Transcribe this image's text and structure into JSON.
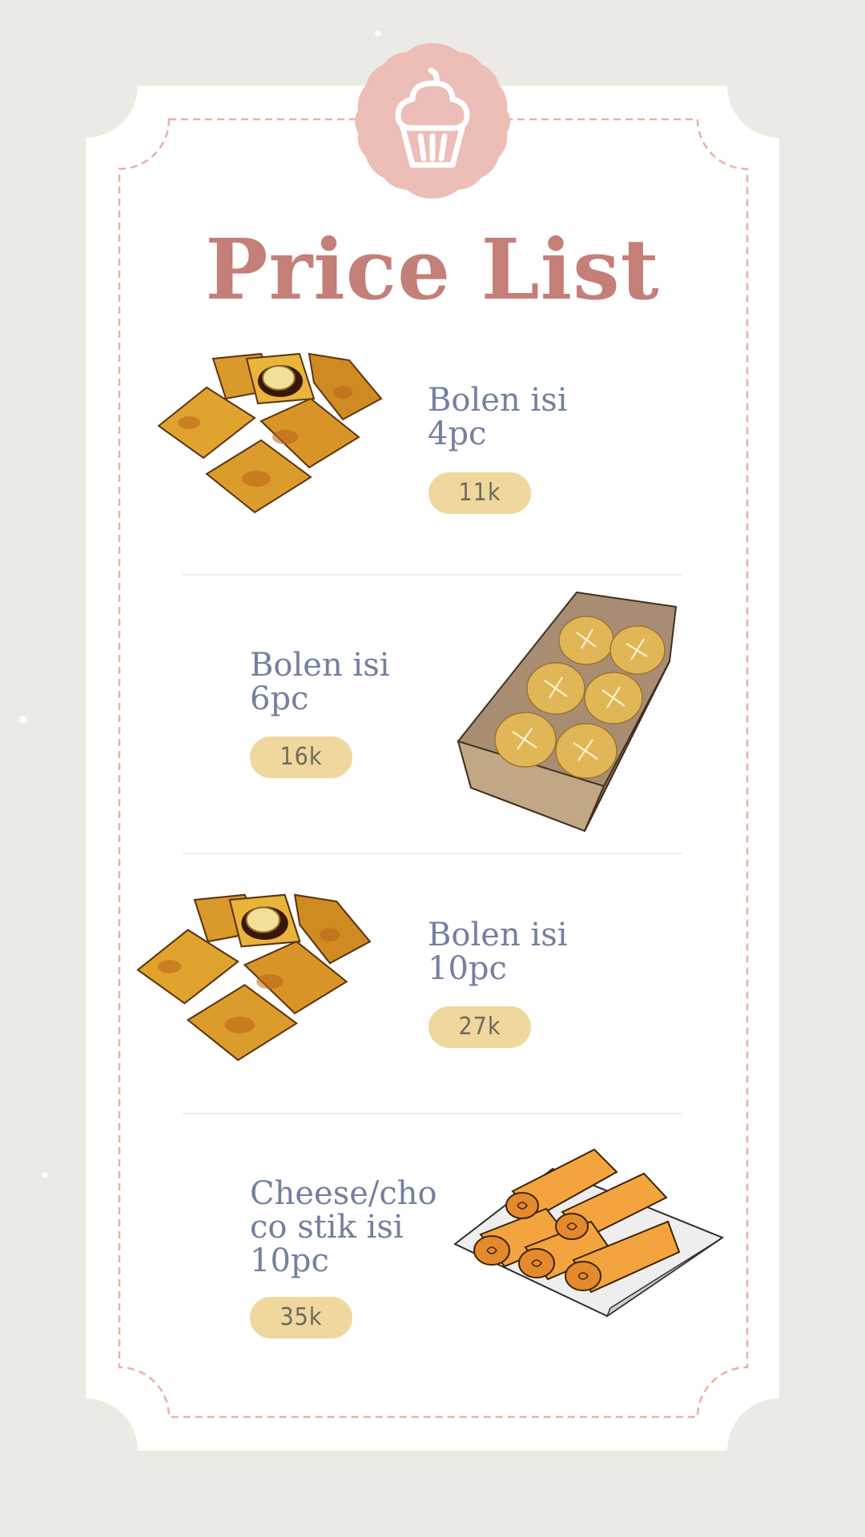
{
  "title": "Price List",
  "badge": {
    "icon": "cupcake-icon"
  },
  "colors": {
    "background": "#ebeae5",
    "card": "#ffffff",
    "title": "#c47f78",
    "badge": "#edbdb7",
    "item_text": "#74809f",
    "price_pill": "#efd79e",
    "frame_dash": "#e8b1a9"
  },
  "items": [
    {
      "name": "Bolen isi\n4pc",
      "price": "11k",
      "image": "bolen-pastry-illustration"
    },
    {
      "name": "Bolen isi\n6pc",
      "price": "16k",
      "image": "bolen-box-illustration"
    },
    {
      "name": "Bolen isi\n10pc",
      "price": "27k",
      "image": "bolen-pastry-illustration"
    },
    {
      "name": "Cheese/cho\nco stik isi\n10pc",
      "price": "35k",
      "image": "cheese-stick-plate-illustration"
    }
  ]
}
